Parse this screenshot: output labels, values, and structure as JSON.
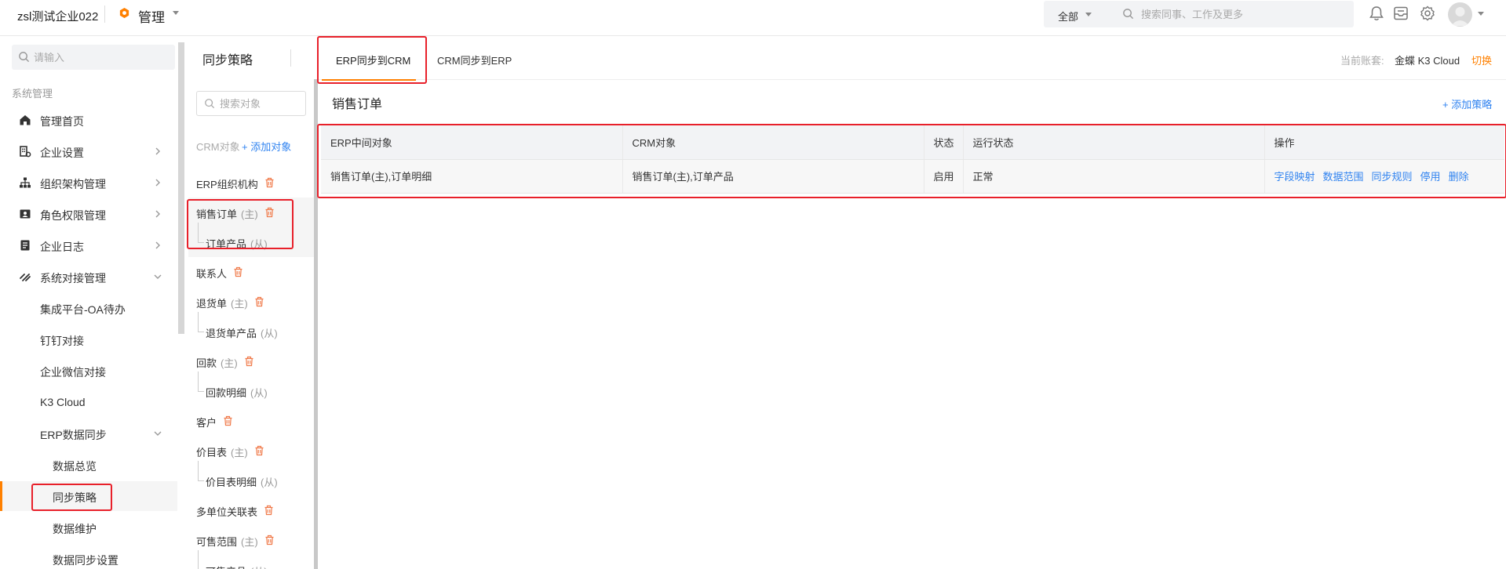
{
  "header": {
    "company": "zsl测试企业022",
    "app_name": "管理",
    "scope_label": "全部",
    "search_placeholder": "搜索同事、工作及更多"
  },
  "sidebar": {
    "search_placeholder": "请输入",
    "section_label": "系统管理",
    "items": [
      {
        "label": "管理首页",
        "icon": "home-icon"
      },
      {
        "label": "企业设置",
        "icon": "building-icon"
      },
      {
        "label": "组织架构管理",
        "icon": "org-chart-icon"
      },
      {
        "label": "角色权限管理",
        "icon": "id-card-icon"
      },
      {
        "label": "企业日志",
        "icon": "document-icon"
      },
      {
        "label": "系统对接管理",
        "icon": "link-icon"
      }
    ],
    "sub_items": [
      "集成平台-OA待办",
      "钉钉对接",
      "企业微信对接",
      "K3 Cloud",
      "ERP数据同步"
    ],
    "erp_sub_items": [
      "数据总览",
      "同步策略",
      "数据维护",
      "数据同步设置"
    ]
  },
  "strategy_panel": {
    "title": "同步策略",
    "search_placeholder": "搜索对象",
    "crm_object_label": "CRM对象",
    "add_object_label": "添加对象",
    "objects": [
      {
        "name": "ERP组织机构",
        "role": "",
        "child": false
      },
      {
        "name": "销售订单",
        "role": "(主)",
        "child": false
      },
      {
        "name": "订单产品",
        "role": "(从)",
        "child": true
      },
      {
        "name": "联系人",
        "role": "",
        "child": false
      },
      {
        "name": "退货单",
        "role": "(主)",
        "child": false
      },
      {
        "name": "退货单产品",
        "role": "(从)",
        "child": true
      },
      {
        "name": "回款",
        "role": "(主)",
        "child": false
      },
      {
        "name": "回款明细",
        "role": "(从)",
        "child": true
      },
      {
        "name": "客户",
        "role": "",
        "child": false
      },
      {
        "name": "价目表",
        "role": "(主)",
        "child": false
      },
      {
        "name": "价目表明细",
        "role": "(从)",
        "child": true
      },
      {
        "name": "多单位关联表",
        "role": "",
        "child": false
      },
      {
        "name": "可售范围",
        "role": "(主)",
        "child": false
      },
      {
        "name": "可售产品",
        "role": "(从)",
        "child": true
      }
    ]
  },
  "main": {
    "tabs": [
      {
        "label": "ERP同步到CRM"
      },
      {
        "label": "CRM同步到ERP"
      }
    ],
    "account_label": "当前账套:",
    "account_value": "金蝶 K3 Cloud",
    "switch_label": "切换",
    "section_title": "销售订单",
    "add_strategy_label": "添加策略",
    "table": {
      "columns": [
        "ERP中间对象",
        "CRM对象",
        "状态",
        "运行状态",
        "操作"
      ],
      "rows": [
        {
          "erp_object": "销售订单(主),订单明细",
          "crm_object": "销售订单(主),订单产品",
          "status": "启用",
          "run_status": "正常",
          "actions": [
            "字段映射",
            "数据范围",
            "同步规则",
            "停用",
            "删除"
          ]
        }
      ]
    }
  },
  "colors": {
    "accent": "#ff8000",
    "link": "#3083f0",
    "highlight_box": "#e8202a"
  }
}
